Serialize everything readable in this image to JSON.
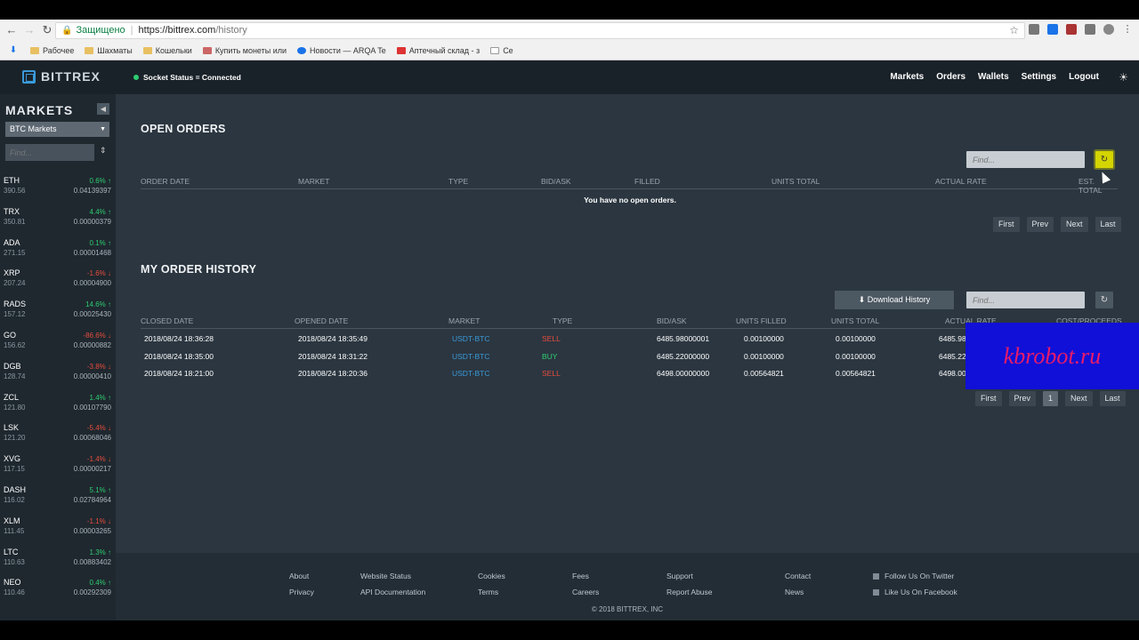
{
  "browser": {
    "secure_label": "Защищено",
    "url_host": "https://bittrex.com",
    "url_path": "/history",
    "bookmarks": [
      "Рабочее",
      "Шахматы",
      "Кошельки",
      "Купить монеты или",
      "Новости — ARQA Te",
      "Аптечный склад - з",
      "Се"
    ]
  },
  "header": {
    "logo": "BITTREX",
    "socket_status": "Socket Status = Connected",
    "nav": [
      "Markets",
      "Orders",
      "Wallets",
      "Settings",
      "Logout"
    ]
  },
  "sidebar": {
    "title": "MARKETS",
    "select": "BTC Markets",
    "find_placeholder": "Find...",
    "markets": [
      {
        "sym": "ETH",
        "vol": "390.56",
        "chg": "0.6% ↑",
        "dir": "up",
        "price": "0.04139397"
      },
      {
        "sym": "TRX",
        "vol": "350.81",
        "chg": "4.4% ↑",
        "dir": "up",
        "price": "0.00000379"
      },
      {
        "sym": "ADA",
        "vol": "271.15",
        "chg": "0.1% ↑",
        "dir": "up",
        "price": "0.00001468"
      },
      {
        "sym": "XRP",
        "vol": "207.24",
        "chg": "-1.6% ↓",
        "dir": "down",
        "price": "0.00004900"
      },
      {
        "sym": "RADS",
        "vol": "157.12",
        "chg": "14.6% ↑",
        "dir": "up",
        "price": "0.00025430"
      },
      {
        "sym": "GO",
        "vol": "156.62",
        "chg": "-86.6% ↓",
        "dir": "down",
        "price": "0.00000882"
      },
      {
        "sym": "DGB",
        "vol": "128.74",
        "chg": "-3.8% ↓",
        "dir": "down",
        "price": "0.00000410"
      },
      {
        "sym": "ZCL",
        "vol": "121.80",
        "chg": "1.4% ↑",
        "dir": "up",
        "price": "0.00107790"
      },
      {
        "sym": "LSK",
        "vol": "121.20",
        "chg": "-5.4% ↓",
        "dir": "down",
        "price": "0.00068046"
      },
      {
        "sym": "XVG",
        "vol": "117.15",
        "chg": "-1.4% ↓",
        "dir": "down",
        "price": "0.00000217"
      },
      {
        "sym": "DASH",
        "vol": "116.02",
        "chg": "5.1% ↑",
        "dir": "up",
        "price": "0.02784964"
      },
      {
        "sym": "XLM",
        "vol": "111.45",
        "chg": "-1.1% ↓",
        "dir": "down",
        "price": "0.00003265"
      },
      {
        "sym": "LTC",
        "vol": "110.63",
        "chg": "1.3% ↑",
        "dir": "up",
        "price": "0.00883402"
      },
      {
        "sym": "NEO",
        "vol": "110.46",
        "chg": "0.4% ↑",
        "dir": "up",
        "price": "0.00292309"
      }
    ]
  },
  "open_orders": {
    "title": "OPEN ORDERS",
    "find_placeholder": "Find...",
    "headers": [
      "ORDER DATE",
      "MARKET",
      "TYPE",
      "BID/ASK",
      "FILLED",
      "UNITS TOTAL",
      "ACTUAL RATE",
      "EST. TOTAL"
    ],
    "empty_message": "You have no open orders.",
    "pager": [
      "First",
      "Prev",
      "Next",
      "Last"
    ]
  },
  "order_history": {
    "title": "MY ORDER HISTORY",
    "download_label": "⬇ Download History",
    "find_placeholder": "Find...",
    "headers": [
      "CLOSED DATE",
      "OPENED DATE",
      "MARKET",
      "TYPE",
      "BID/ASK",
      "UNITS FILLED",
      "UNITS TOTAL",
      "ACTUAL RATE",
      "COST/PROCEEDS"
    ],
    "rows": [
      {
        "closed": "2018/08/24 18:36:28",
        "opened": "2018/08/24 18:35:49",
        "market": "USDT-BTC",
        "type": "SELL",
        "bidask": "6485.98000001",
        "filled": "0.00100000",
        "total": "0.00100000",
        "rate": "6485.98"
      },
      {
        "closed": "2018/08/24 18:35:00",
        "opened": "2018/08/24 18:31:22",
        "market": "USDT-BTC",
        "type": "BUY",
        "bidask": "6485.22000000",
        "filled": "0.00100000",
        "total": "0.00100000",
        "rate": "6485.22"
      },
      {
        "closed": "2018/08/24 18:21:00",
        "opened": "2018/08/24 18:20:36",
        "market": "USDT-BTC",
        "type": "SELL",
        "bidask": "6498.00000000",
        "filled": "0.00564821",
        "total": "0.00564821",
        "rate": "6498.00"
      }
    ],
    "pager": [
      "First",
      "Prev",
      "1",
      "Next",
      "Last"
    ]
  },
  "watermark": "kbrobot.ru",
  "footer": {
    "col1": [
      "About",
      "Privacy"
    ],
    "col2": [
      "Website Status",
      "API Documentation"
    ],
    "col3": [
      "Cookies",
      "Terms"
    ],
    "col4": [
      "Fees",
      "Careers"
    ],
    "col5": [
      "Support",
      "Report Abuse"
    ],
    "col6": [
      "Contact",
      "News"
    ],
    "social": [
      "Follow Us On Twitter",
      "Like Us On Facebook"
    ],
    "copyright": "© 2018 BITTREX, INC"
  }
}
